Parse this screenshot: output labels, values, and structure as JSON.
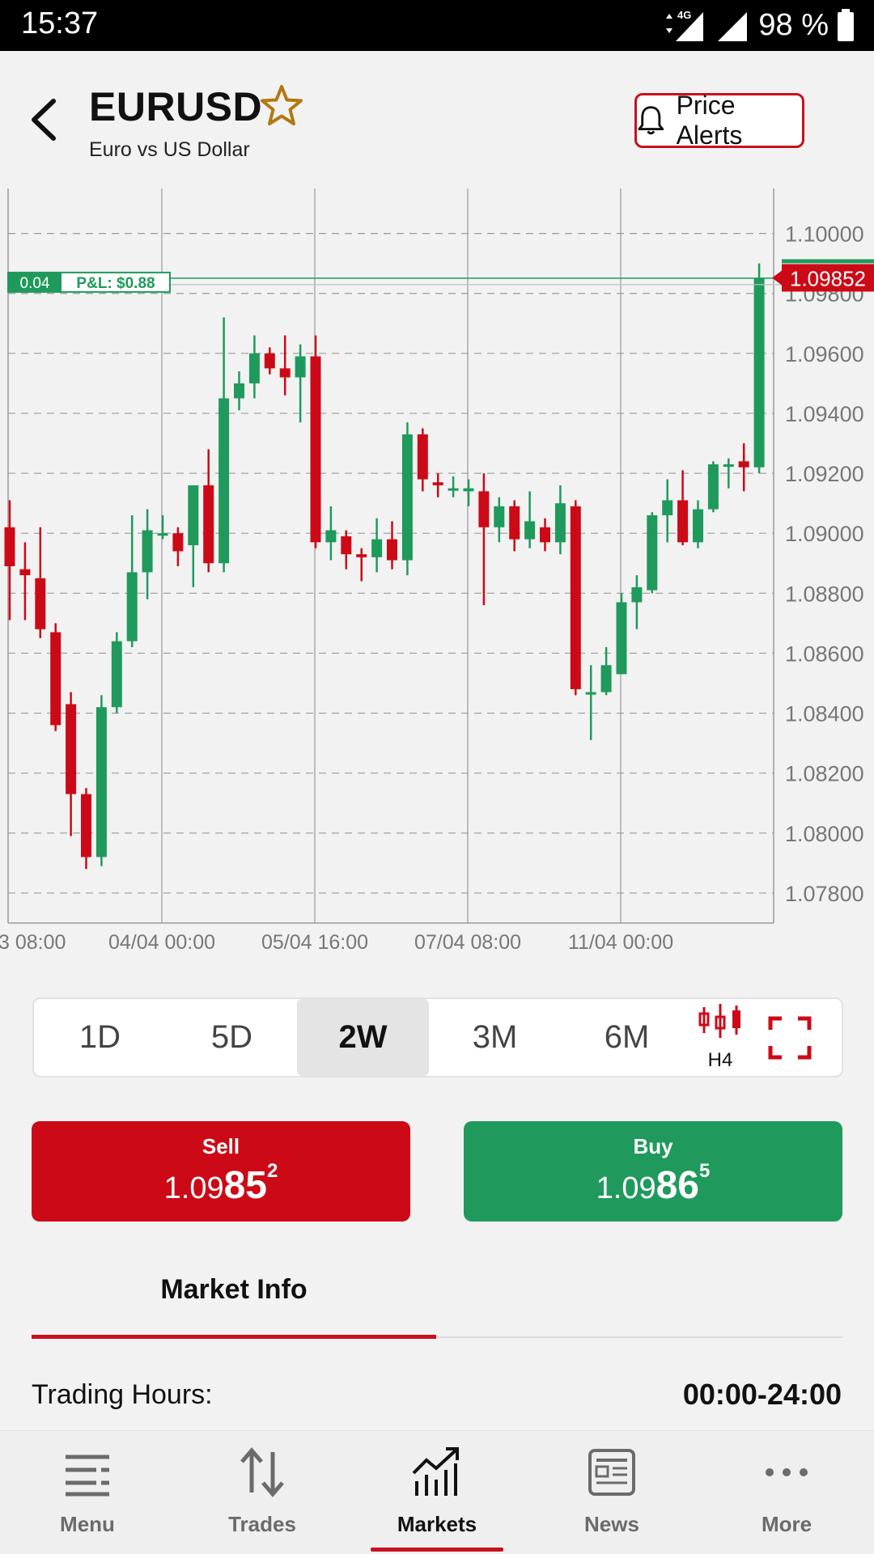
{
  "status_bar": {
    "time": "15:37",
    "network": "4G",
    "battery": "98 %"
  },
  "header": {
    "symbol": "EURUSD",
    "description": "Euro vs US Dollar",
    "price_alerts_label": "Price Alerts"
  },
  "chart_data": {
    "type": "candlestick",
    "ylim": [
      1.077,
      1.1015
    ],
    "y_ticks": [
      "1.10000",
      "1.09800",
      "1.09600",
      "1.09400",
      "1.09200",
      "1.09000",
      "1.08800",
      "1.08600",
      "1.08400",
      "1.08200",
      "1.08000",
      "1.07800"
    ],
    "y_tick_values": [
      1.1,
      1.098,
      1.096,
      1.094,
      1.092,
      1.09,
      1.088,
      1.086,
      1.084,
      1.082,
      1.08,
      1.078
    ],
    "x_tick_labels": [
      "3 08:00",
      "04/04 00:00",
      "05/04 16:00",
      "07/04 08:00",
      "11/04 00:00"
    ],
    "current_price_label": "1.09852",
    "current_price": 1.09852,
    "position_volume": "0.04",
    "position_pl": "P&L: $0.88",
    "position_price": 1.0984,
    "colors": {
      "up": "#1f9a5c",
      "down": "#cc0a17"
    },
    "candles": [
      {
        "o": 1.0902,
        "h": 1.0911,
        "l": 1.0871,
        "c": 1.0889
      },
      {
        "o": 1.0888,
        "h": 1.0897,
        "l": 1.0871,
        "c": 1.0886
      },
      {
        "o": 1.0885,
        "h": 1.0902,
        "l": 1.0865,
        "c": 1.0868
      },
      {
        "o": 1.0867,
        "h": 1.087,
        "l": 1.0834,
        "c": 1.0836
      },
      {
        "o": 1.0843,
        "h": 1.0847,
        "l": 1.0799,
        "c": 1.0813
      },
      {
        "o": 1.0813,
        "h": 1.0815,
        "l": 1.0788,
        "c": 1.0792
      },
      {
        "o": 1.0792,
        "h": 1.0846,
        "l": 1.0789,
        "c": 1.0842
      },
      {
        "o": 1.0842,
        "h": 1.0867,
        "l": 1.084,
        "c": 1.0864
      },
      {
        "o": 1.0864,
        "h": 1.0906,
        "l": 1.0862,
        "c": 1.0887
      },
      {
        "o": 1.0887,
        "h": 1.0908,
        "l": 1.0878,
        "c": 1.0901
      },
      {
        "o": 1.09,
        "h": 1.0906,
        "l": 1.0898,
        "c": 1.09
      },
      {
        "o": 1.09,
        "h": 1.0902,
        "l": 1.0889,
        "c": 1.0894
      },
      {
        "o": 1.0896,
        "h": 1.0914,
        "l": 1.0882,
        "c": 1.0916
      },
      {
        "o": 1.0916,
        "h": 1.0928,
        "l": 1.0887,
        "c": 1.089
      },
      {
        "o": 1.089,
        "h": 1.0972,
        "l": 1.0887,
        "c": 1.0945
      },
      {
        "o": 1.0945,
        "h": 1.0954,
        "l": 1.0941,
        "c": 1.095
      },
      {
        "o": 1.095,
        "h": 1.0966,
        "l": 1.0945,
        "c": 1.096
      },
      {
        "o": 1.096,
        "h": 1.0962,
        "l": 1.0953,
        "c": 1.0955
      },
      {
        "o": 1.0955,
        "h": 1.0966,
        "l": 1.0946,
        "c": 1.0952
      },
      {
        "o": 1.0952,
        "h": 1.0963,
        "l": 1.0937,
        "c": 1.0959
      },
      {
        "o": 1.0959,
        "h": 1.0966,
        "l": 1.0895,
        "c": 1.0897
      },
      {
        "o": 1.0897,
        "h": 1.0909,
        "l": 1.0891,
        "c": 1.0901
      },
      {
        "o": 1.0899,
        "h": 1.0901,
        "l": 1.0888,
        "c": 1.0893
      },
      {
        "o": 1.0893,
        "h": 1.0895,
        "l": 1.0884,
        "c": 1.0892
      },
      {
        "o": 1.0892,
        "h": 1.0905,
        "l": 1.0887,
        "c": 1.0898
      },
      {
        "o": 1.0898,
        "h": 1.0904,
        "l": 1.0888,
        "c": 1.0891
      },
      {
        "o": 1.0891,
        "h": 1.0937,
        "l": 1.0886,
        "c": 1.0933
      },
      {
        "o": 1.0933,
        "h": 1.0935,
        "l": 1.0914,
        "c": 1.0918
      },
      {
        "o": 1.0917,
        "h": 1.092,
        "l": 1.0912,
        "c": 1.0916
      },
      {
        "o": 1.0915,
        "h": 1.0919,
        "l": 1.0912,
        "c": 1.0915
      },
      {
        "o": 1.0914,
        "h": 1.0918,
        "l": 1.0909,
        "c": 1.0915
      },
      {
        "o": 1.0914,
        "h": 1.092,
        "l": 1.0876,
        "c": 1.0902
      },
      {
        "o": 1.0902,
        "h": 1.0912,
        "l": 1.0897,
        "c": 1.0909
      },
      {
        "o": 1.0909,
        "h": 1.0911,
        "l": 1.0894,
        "c": 1.0898
      },
      {
        "o": 1.0898,
        "h": 1.0914,
        "l": 1.0895,
        "c": 1.0904
      },
      {
        "o": 1.0902,
        "h": 1.0905,
        "l": 1.0894,
        "c": 1.0897
      },
      {
        "o": 1.0897,
        "h": 1.0916,
        "l": 1.0893,
        "c": 1.091
      },
      {
        "o": 1.0909,
        "h": 1.0911,
        "l": 1.0846,
        "c": 1.0848
      },
      {
        "o": 1.0847,
        "h": 1.0856,
        "l": 1.0831,
        "c": 1.0847
      },
      {
        "o": 1.0847,
        "h": 1.0862,
        "l": 1.0846,
        "c": 1.0856
      },
      {
        "o": 1.0853,
        "h": 1.088,
        "l": 1.0853,
        "c": 1.0877
      },
      {
        "o": 1.0877,
        "h": 1.0886,
        "l": 1.0868,
        "c": 1.0882
      },
      {
        "o": 1.0881,
        "h": 1.0907,
        "l": 1.088,
        "c": 1.0906
      },
      {
        "o": 1.0906,
        "h": 1.0918,
        "l": 1.0897,
        "c": 1.0911
      },
      {
        "o": 1.0911,
        "h": 1.0921,
        "l": 1.0896,
        "c": 1.0897
      },
      {
        "o": 1.0897,
        "h": 1.0911,
        "l": 1.0895,
        "c": 1.0908
      },
      {
        "o": 1.0908,
        "h": 1.0924,
        "l": 1.0907,
        "c": 1.0923
      },
      {
        "o": 1.0923,
        "h": 1.0925,
        "l": 1.0915,
        "c": 1.0923
      },
      {
        "o": 1.0924,
        "h": 1.093,
        "l": 1.0914,
        "c": 1.0922
      },
      {
        "o": 1.0922,
        "h": 1.099,
        "l": 1.092,
        "c": 1.0985
      }
    ]
  },
  "timeframes": [
    "1D",
    "5D",
    "2W",
    "3M",
    "6M"
  ],
  "active_timeframe": "2W",
  "chart_type_label": "H4",
  "sell": {
    "label": "Sell",
    "price_prefix": "1.09",
    "price_big": "85",
    "price_pip": "2"
  },
  "buy": {
    "label": "Buy",
    "price_prefix": "1.09",
    "price_big": "86",
    "price_pip": "5"
  },
  "market_info": {
    "tab_label": "Market Info",
    "hours_label": "Trading Hours:",
    "hours_value": "00:00-24:00"
  },
  "nav": [
    {
      "label": "Menu",
      "icon": "menu-icon"
    },
    {
      "label": "Trades",
      "icon": "trades-icon"
    },
    {
      "label": "Markets",
      "icon": "markets-icon"
    },
    {
      "label": "News",
      "icon": "news-icon"
    },
    {
      "label": "More",
      "icon": "more-icon"
    }
  ],
  "active_nav": "Markets"
}
